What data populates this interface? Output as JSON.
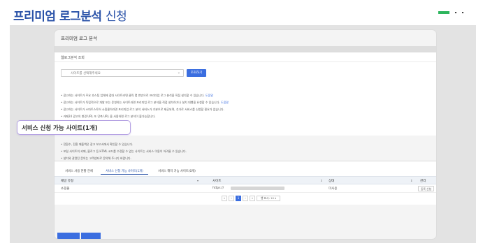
{
  "header": {
    "title_bold": "프리미엄 로그분석",
    "title_light": "신청"
  },
  "card": {
    "title": "프리미엄 로그 분석"
  },
  "inquiry": {
    "heading": "웹로그분석 조회",
    "select_placeholder": "사이트를 선택해주세요",
    "search_button": "조회하기"
  },
  "notes": [
    {
      "text": "• 광고하는 사이트가 주요 호스팅 업체에 접대 사이트라면 클릭 몇 번만으로 프리미엄 로그 분석을 직접 설치할 수 있습니다.",
      "link": "도움말"
    },
    {
      "text": "• 광고하는 사이트가 독립적으로 개발 또는 운영하는 사이트라면 프리미엄 로그 분석을 직접 설치하거나 설치 대행을 요청할 수 있습니다.",
      "link": "도움말"
    },
    {
      "text": "• 광고하는 사이트가 스마트스토어 쇼핑몰이라면 프리미엄 로그 분석 서비스가 기본으로 제공되며, 추가로 서비스를 신청할 필요가 없습니다.",
      "link": ""
    },
    {
      "text": "• 카페24 광고의 변경 URL 또 단축 URL 을 사용하면 로그 분석이 불가능합니다.",
      "link": ""
    }
  ],
  "reference": {
    "title": "참고하세요!",
    "lines": [
      "• 전환수, 전환 매출액은 광고 보고서에서 확인할 수 있습니다.",
      "• 포털 사이트의 카페, 블로그 등 HTML 코드를 수정할 수 없는 사이트는 서비스 이용이 어려울 수 있습니다.",
      "• 설치와 관련된 문의는 고객센터로 문의해 주시기 바랍니다."
    ]
  },
  "tabs": [
    {
      "label": "서비스 사용 현황 전체",
      "active": false
    },
    {
      "label": "서비스 신청 가능 사이트(1개)",
      "active": true
    },
    {
      "label": "서비스 해지 가능 사이트(0개)",
      "active": false
    }
  ],
  "table": {
    "columns": [
      "채널 유형",
      "사이트",
      "상태",
      "관리"
    ],
    "rows": [
      {
        "channel_type": "쇼핑몰",
        "site": "https://",
        "status": "미사용",
        "action": "등록 신청"
      }
    ]
  },
  "pagination": {
    "first": "«",
    "prev": "‹",
    "current": "1",
    "next": "›",
    "last": "»",
    "page_size": "행 표시: 10 ▾"
  },
  "callout": {
    "text": "서비스 신청 가능 사이트(1개)"
  },
  "colors": {
    "title": "#2a52a8",
    "accent": "#3b6ee0",
    "callout_border": "#b5a2e3",
    "corner_deco": "#2db55d"
  }
}
